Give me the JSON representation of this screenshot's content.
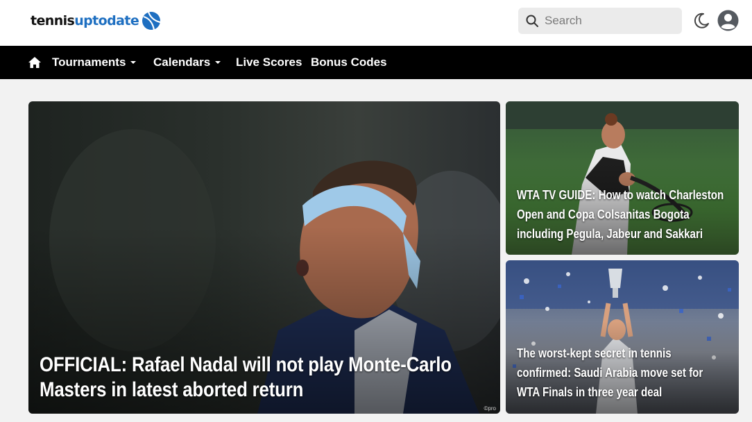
{
  "brand": {
    "part1": "tennis",
    "part2": "uptodate",
    "ball_icon": "tennis-ball-icon",
    "accent": "#1e6fc1"
  },
  "header": {
    "search": {
      "placeholder": "Search",
      "icon": "search-icon"
    },
    "theme_toggle_icon": "moon-icon",
    "account_icon": "user-avatar-icon"
  },
  "nav": {
    "home_icon": "home-icon",
    "items": [
      {
        "label": "Tournaments",
        "has_dropdown": true
      },
      {
        "label": "Calendars",
        "has_dropdown": true
      },
      {
        "label": "Live Scores",
        "has_dropdown": false
      },
      {
        "label": "Bonus Codes",
        "has_dropdown": false
      }
    ]
  },
  "featured": {
    "main": {
      "headline_line1": "OFFICIAL: Rafael Nadal will not play Monte-Carlo",
      "headline_line2": "Masters in latest aborted return",
      "credit": "©pro"
    },
    "side": [
      {
        "headline_line1": "WTA TV GUIDE: How to watch Charleston",
        "headline_line2": "Open and Copa Colsanitas Bogota",
        "headline_line3": "including Pegula, Jabeur and Sakkari"
      },
      {
        "headline_line1": "The worst-kept secret in tennis",
        "headline_line2": "confirmed: Saudi Arabia move set for",
        "headline_line3": "WTA Finals in three year deal"
      }
    ]
  }
}
